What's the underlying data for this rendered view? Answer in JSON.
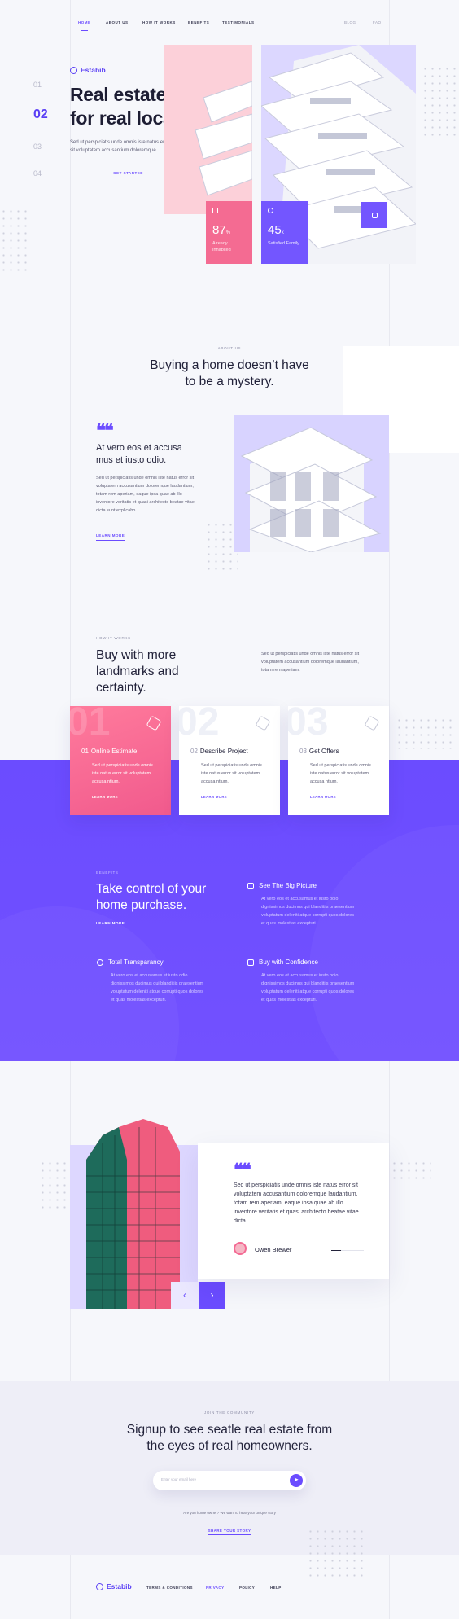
{
  "nav": {
    "items": [
      "HOME",
      "ABOUT US",
      "HOW IT WORKS",
      "BENEFITS",
      "TESTIMONIALS"
    ],
    "right": [
      "BLOG",
      "FAQ"
    ]
  },
  "slides": [
    "01",
    "02",
    "03",
    "04"
  ],
  "brand": "Estabib",
  "hero": {
    "title": "Real estate advice for real locals.",
    "text": "Sed ut perspiciatis unde omnis iste natus error sit voluptatem accusantium doloremque.",
    "cta": "GET STARTED",
    "stat1": {
      "value": "87",
      "unit": "%",
      "label": "Already Inhabited"
    },
    "stat2": {
      "value": "45",
      "unit": "k",
      "label": "Satisfied Family"
    }
  },
  "about": {
    "kicker": "ABOUT US",
    "title": "Buying a home doesn’t have to be a mystery.",
    "quote_title": "At vero eos et accusa mus et iusto odio.",
    "text": "Sed ut perspiciatis unde omnis iste natus error sit voluptatem accusantium doloremque laudantium, totam rem aperiam, eaque ipsa quae ab illo inventore veritatis et quasi architecto beatae vitae dicta sunt explicabo.",
    "link": "LEARN MORE"
  },
  "how": {
    "kicker": "HOW IT WORKS",
    "title": "Buy with more landmarks and certainty.",
    "text": "Sed ut perspiciatis unde omnis iste natus error sit voluptatem accusantium doloremque laudantium, totam rem aperiam.",
    "cards": [
      {
        "big": "01",
        "num": "01",
        "title": "Online Estimate",
        "text": "Sed ut perspiciatis unde omnis iste natus error sit voluptatem accusa ntium.",
        "link": "LEARN MORE"
      },
      {
        "big": "02",
        "num": "02",
        "title": "Describe Project",
        "text": "Sed ut perspiciatis unde omnis iste natus error sit voluptatem accusa ntium.",
        "link": "LEARN MORE"
      },
      {
        "big": "03",
        "num": "03",
        "title": "Get Offers",
        "text": "Sed ut perspiciatis unde omnis iste natus error sit voluptatem accusa ntium.",
        "link": "LEARN MORE"
      }
    ]
  },
  "benefits": {
    "kicker": "BENEFITS",
    "title": "Take control of your home purchase.",
    "link": "LEARN MORE",
    "features": [
      {
        "title": "See The Big Picture",
        "text": "At vero eos et accusamus et iusto odio dignissimos ducimus qui blanditiis praesentium voluptatum deleniti atque corrupti quos dolores et quas molestias excepturi."
      },
      {
        "title": "Total Transparancy",
        "text": "At vero eos et accusamus et iusto odio dignissimos ducimus qui blanditiis praesentium voluptatum deleniti atque corrupti quos dolores et quas molestias excepturi."
      },
      {
        "title": "Buy with Confidence",
        "text": "At vero eos et accusamus et iusto odio dignissimos ducimus qui blanditiis praesentium voluptatum deleniti atque corrupti quos dolores et quas molestias excepturi."
      }
    ]
  },
  "testimonial": {
    "text": "Sed ut perspiciatis unde omnis iste natus error sit voluptatem accusantium doloremque laudantium, totam rem aperiam, eaque ipsa quae ab illo inventore veritatis et quasi architecto beatae vitae dicta.",
    "author": "Owen Brewer",
    "prev": "‹",
    "next": "›"
  },
  "signup": {
    "kicker": "JOIN THE COMMUNITY",
    "title": "Signup to see seatle real estate from the eyes of real homeowners.",
    "placeholder": "Enter your email here",
    "submit": "➤",
    "note": "Are you home owner? We want to hear your unique story",
    "link": "SHARE YOUR STORY"
  },
  "footer": {
    "brand": "Estabib",
    "links": [
      "TERMS & CONDITIONS",
      "PRIVACY",
      "POLICY",
      "HELP"
    ]
  },
  "colors": {
    "accent": "#6b4cff",
    "pink": "#f36a93",
    "lavender": "#d8d3ff"
  }
}
